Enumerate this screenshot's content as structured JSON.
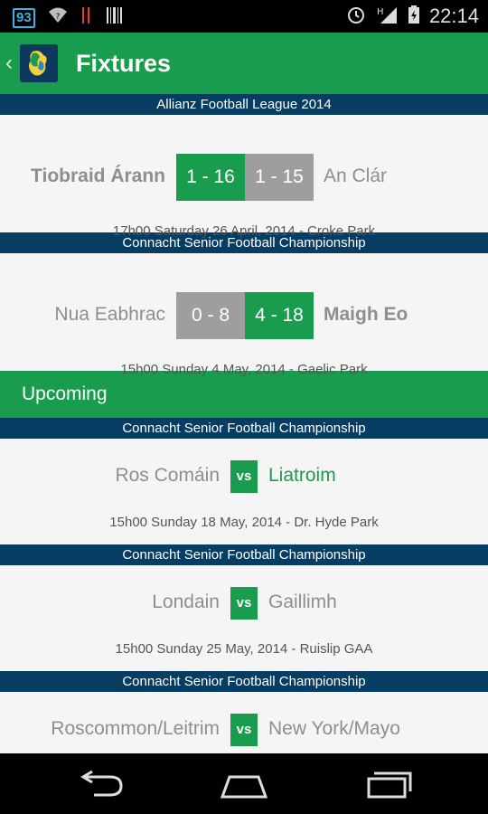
{
  "status_bar": {
    "badge": "93",
    "time": "22:14",
    "signal_label": "H",
    "icons": [
      "notification-badge-icon",
      "wifi-question-icon",
      "barcode-icon",
      "alarm-icon",
      "signal-icon",
      "battery-charging-icon"
    ]
  },
  "app_bar": {
    "title": "Fixtures",
    "back_icon": "chevron-left-icon",
    "logo_icon": "app-logo-icon"
  },
  "results": [
    {
      "competition": "Allianz Football League 2014",
      "home": "Tiobraid Árann",
      "home_score": "1 - 16",
      "away_score": "1 - 15",
      "away": "An Clár",
      "winner": "home",
      "info": "17h00 Saturday 26 April, 2014 - Croke Park"
    },
    {
      "competition": "Connacht Senior Football Championship",
      "home": "Nua Eabhrac",
      "home_score": "0 - 8",
      "away_score": "4 - 18",
      "away": "Maigh Eo",
      "winner": "away",
      "info": "15h00 Sunday 4 May, 2014 - Gaelic Park"
    }
  ],
  "upcoming_section": {
    "label": "Upcoming"
  },
  "upcoming": [
    {
      "competition": "Connacht Senior Football Championship",
      "home": "Ros Comáin",
      "vs": "vs",
      "away": "Liatroim",
      "info": "15h00 Sunday 18 May, 2014 - Dr. Hyde Park"
    },
    {
      "competition": "Connacht Senior Football Championship",
      "home": "Londain",
      "vs": "vs",
      "away": "Gaillimh",
      "info": "15h00 Sunday 25 May, 2014 - Ruislip GAA"
    },
    {
      "competition": "Connacht Senior Football Championship",
      "home": "Roscommon/Leitrim",
      "vs": "vs",
      "away": "New York/Mayo",
      "info": ""
    }
  ],
  "colors": {
    "green": "#1a9c4f",
    "navy": "#073d63",
    "grey_score": "#9e9e9e"
  },
  "nav": {
    "icons": [
      "back-nav-icon",
      "home-nav-icon",
      "recents-nav-icon"
    ]
  }
}
